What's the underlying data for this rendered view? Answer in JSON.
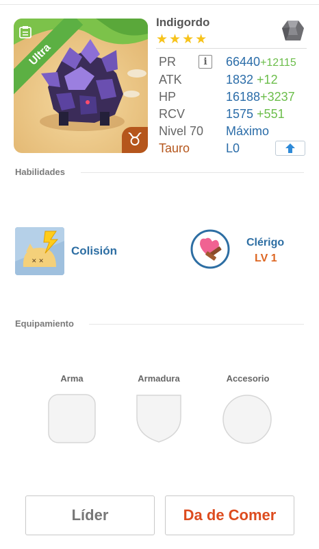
{
  "monster": {
    "name": "Indigordo",
    "rarity_label": "Ultra",
    "stars": "★★★★",
    "zodiac_symbol": "♉",
    "element_icon": "earth-element-icon"
  },
  "stats": [
    {
      "label": "PR",
      "value": "66440",
      "bonus": "+12115"
    },
    {
      "label": "ATK",
      "value": "1832",
      "bonus": " +12"
    },
    {
      "label": "HP",
      "value": "16188",
      "bonus": "+3237"
    },
    {
      "label": "RCV",
      "value": "1575",
      "bonus": " +551"
    },
    {
      "label": "Nivel 70",
      "value": "Máximo",
      "bonus": ""
    },
    {
      "label": "Tauro",
      "value": "L0",
      "bonus": ""
    }
  ],
  "info_symbol": "i",
  "sections": {
    "skills_title": "Habilidades",
    "equipment_title": "Equipamiento"
  },
  "skills": {
    "skill_name": "Colisión",
    "role_name": "Clérigo",
    "role_level": "LV 1"
  },
  "equipment": {
    "weapon_label": "Arma",
    "armor_label": "Armadura",
    "accessory_label": "Accesorio"
  },
  "buttons": {
    "leader": "Líder",
    "feed": "Da de Comer"
  },
  "colors": {
    "accent_blue": "#2a6ca8",
    "bonus_green": "#6bbd4a",
    "tauro_brown": "#b5561c",
    "feed_red": "#dd4c1f"
  }
}
